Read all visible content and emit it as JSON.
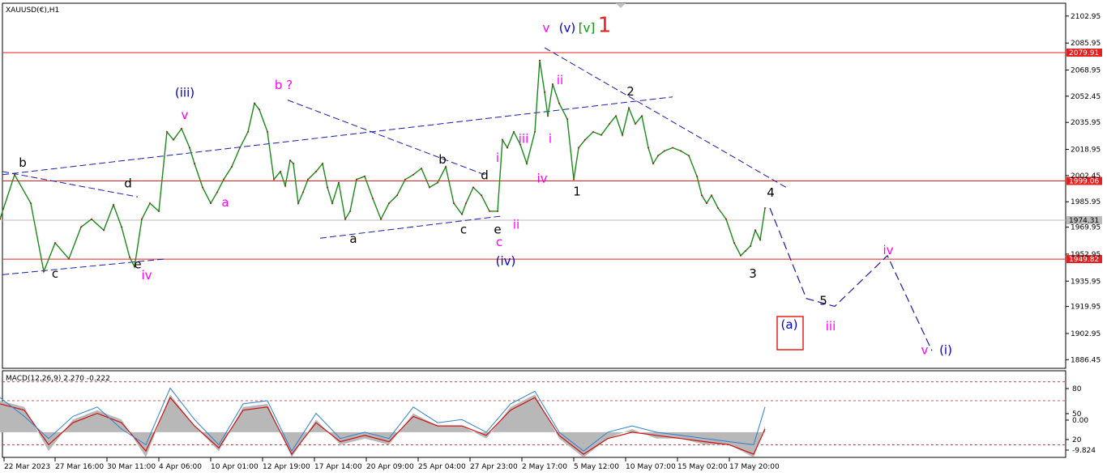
{
  "chart_data": {
    "type": "line",
    "title": "XAUUSD(€),H1",
    "price_panel": {
      "ylim": [
        1881.0,
        2110.0
      ],
      "y_ticks": [
        "2102.95",
        "2085.95",
        "2068.95",
        "2052.45",
        "2035.95",
        "2018.95",
        "2002.45",
        "1985.95",
        "1969.95",
        "1952.95",
        "1935.95",
        "1919.95",
        "1902.95",
        "1886.45"
      ],
      "y_tick_values": [
        2102.95,
        2085.95,
        2068.95,
        2052.45,
        2035.95,
        2018.95,
        2002.45,
        1985.95,
        1969.95,
        1952.95,
        1935.95,
        1919.95,
        1902.95,
        1886.45
      ],
      "levels": [
        {
          "label": "2079.91",
          "value": 2079.91,
          "color": "#e52020"
        },
        {
          "label": "1999.06",
          "value": 1999.06,
          "color": "#e52020"
        },
        {
          "label": "1974.31",
          "value": 1974.31,
          "color": "#bbbbbb"
        },
        {
          "label": "1949.82",
          "value": 1949.82,
          "color": "#e52020"
        }
      ],
      "price_path_bars": [
        0,
        18,
        38,
        54,
        68,
        85,
        100,
        113,
        128,
        140,
        150,
        160,
        166,
        175,
        185,
        196,
        206,
        214,
        224,
        234,
        240,
        250,
        260,
        268,
        276,
        286,
        296,
        306,
        314,
        320,
        330,
        338,
        346,
        352,
        358,
        362,
        368,
        374,
        380,
        390,
        398,
        404,
        410,
        418,
        426,
        432,
        440,
        450,
        460,
        470,
        480,
        490,
        500,
        510,
        520,
        530,
        540,
        550,
        560,
        570,
        575,
        584,
        594,
        604,
        614,
        620,
        626,
        634,
        642,
        650,
        660,
        666,
        672,
        676,
        682,
        690,
        700,
        708,
        714,
        722,
        732,
        742,
        752,
        760,
        768,
        776,
        784,
        792,
        800,
        806,
        812,
        820,
        830,
        840,
        850,
        860,
        866,
        872,
        878,
        886,
        896,
        906,
        914,
        920,
        926,
        932,
        938,
        944
      ],
      "price_path_values": [
        1975,
        2003,
        1985,
        1942,
        1960,
        1950,
        1970,
        1975,
        1968,
        1984,
        1970,
        1951,
        1945,
        1975,
        1985,
        1980,
        2030,
        2025,
        2032,
        2020,
        2010,
        1995,
        1985,
        1992,
        2000,
        2008,
        2020,
        2030,
        2048,
        2044,
        2030,
        2000,
        2005,
        1996,
        2012,
        2010,
        1985,
        1992,
        2000,
        2005,
        2010,
        1995,
        1985,
        1998,
        1975,
        1980,
        2000,
        2002,
        1988,
        1975,
        1985,
        1990,
        2000,
        2003,
        2007,
        1995,
        1998,
        2008,
        1985,
        1978,
        1985,
        1995,
        1990,
        1980,
        1980,
        2025,
        2020,
        2030,
        2022,
        2010,
        2030,
        2075,
        2055,
        2040,
        2060,
        2048,
        2038,
        2000,
        2020,
        2025,
        2030,
        2028,
        2035,
        2040,
        2028,
        2045,
        2035,
        2040,
        2020,
        2010,
        2015,
        2018,
        2020,
        2018,
        2015,
        2002,
        1990,
        1985,
        1990,
        1982,
        1975,
        1960,
        1952,
        1955,
        1958,
        1968,
        1962,
        1982
      ],
      "projection_x_bars": [
        950,
        995,
        1030,
        1095,
        1150
      ],
      "projection_y_values": [
        1982,
        1925,
        1920,
        1952,
        1892
      ],
      "wave_labels": [
        {
          "text": "b",
          "bar": 28,
          "value": 2008,
          "color": "#000000"
        },
        {
          "text": "c",
          "bar": 68,
          "value": 1938,
          "color": "#000000"
        },
        {
          "text": "d",
          "bar": 158,
          "value": 1995,
          "color": "#000000"
        },
        {
          "text": "e",
          "bar": 170,
          "value": 1944,
          "color": "#000000"
        },
        {
          "text": "iv",
          "bar": 181,
          "value": 1937,
          "color": "#ff00ff"
        },
        {
          "text": "(iii)",
          "bar": 228,
          "value": 2052,
          "color": "#0000cc"
        },
        {
          "text": "v",
          "bar": 228,
          "value": 2038,
          "color": "#ff00ff"
        },
        {
          "text": "a",
          "bar": 278,
          "value": 1983,
          "color": "#ff00ff"
        },
        {
          "text": "b ?",
          "bar": 350,
          "value": 2057,
          "color": "#ff00ff"
        },
        {
          "text": "a",
          "bar": 436,
          "value": 1960,
          "color": "#000000"
        },
        {
          "text": "b",
          "bar": 546,
          "value": 2010,
          "color": "#000000"
        },
        {
          "text": "c",
          "bar": 572,
          "value": 1966,
          "color": "#000000"
        },
        {
          "text": "d",
          "bar": 598,
          "value": 2000,
          "color": "#000000"
        },
        {
          "text": "e",
          "bar": 614,
          "value": 1966,
          "color": "#000000"
        },
        {
          "text": "c",
          "bar": 616,
          "value": 1958,
          "color": "#ff00ff"
        },
        {
          "text": "(iv)",
          "bar": 624,
          "value": 1946,
          "color": "#0000cc"
        },
        {
          "text": "i",
          "bar": 614,
          "value": 2011,
          "color": "#ff00ff"
        },
        {
          "text": "ii",
          "bar": 637,
          "value": 1969,
          "color": "#ff00ff"
        },
        {
          "text": "iii",
          "bar": 646,
          "value": 2023,
          "color": "#ff00ff"
        },
        {
          "text": "iv",
          "bar": 669,
          "value": 1998,
          "color": "#ff00ff"
        },
        {
          "text": "i",
          "bar": 679,
          "value": 2023,
          "color": "#ff00ff"
        },
        {
          "text": "ii",
          "bar": 691,
          "value": 2060,
          "color": "#ff00ff"
        },
        {
          "text": "v",
          "bar": 674,
          "value": 2093,
          "color": "#ff00ff"
        },
        {
          "text": "(v)",
          "bar": 700,
          "value": 2093,
          "color": "#0000cc"
        },
        {
          "text": "[v]",
          "bar": 724,
          "value": 2093,
          "color": "#009900"
        },
        {
          "text": "1",
          "bar": 746,
          "value": 2093,
          "color": "#e52020"
        },
        {
          "text": "1",
          "bar": 712,
          "value": 1990,
          "color": "#000000"
        },
        {
          "text": "2",
          "bar": 778,
          "value": 2053,
          "color": "#000000"
        },
        {
          "text": "4",
          "bar": 951,
          "value": 1989,
          "color": "#000000"
        },
        {
          "text": "3",
          "bar": 929,
          "value": 1938,
          "color": "#000000"
        },
        {
          "text": "5",
          "bar": 1016,
          "value": 1921,
          "color": "#000000"
        },
        {
          "text": "iv",
          "bar": 1096,
          "value": 1953,
          "color": "#ff00ff"
        },
        {
          "text": "iii",
          "bar": 1025,
          "value": 1905,
          "color": "#ff00ff"
        },
        {
          "text": "(a)",
          "bar": 974,
          "value": 1906,
          "color": "#0000cc"
        },
        {
          "text": "v",
          "bar": 1141,
          "value": 1890,
          "color": "#ff00ff"
        },
        {
          "text": "(i)",
          "bar": 1167,
          "value": 1890,
          "color": "#0000cc"
        }
      ]
    },
    "macd_panel": {
      "title": "MACD(12,26,9) 2.270 -0.222",
      "y_ticks": [
        "80",
        "50",
        "0.00",
        "20",
        "-9.824"
      ],
      "y_tick_values": [
        80,
        50,
        0,
        -20,
        -9.824
      ],
      "dotted_levels": [
        80,
        50,
        -20
      ],
      "ylim": [
        -40,
        95
      ],
      "hist_bars": [
        0,
        30,
        60,
        90,
        120,
        150,
        180,
        210,
        240,
        270,
        300,
        330,
        360,
        390,
        420,
        450,
        480,
        510,
        540,
        570,
        600,
        630,
        660,
        690,
        720,
        750,
        780,
        810,
        840,
        870,
        900,
        930,
        944
      ],
      "hist_values": [
        50,
        40,
        -30,
        20,
        35,
        20,
        -40,
        60,
        10,
        -30,
        40,
        45,
        -40,
        20,
        -20,
        -10,
        -20,
        30,
        10,
        10,
        -10,
        40,
        60,
        -10,
        -40,
        -10,
        5,
        -10,
        -10,
        -20,
        -20,
        -40,
        10
      ],
      "signal_values": [
        45,
        35,
        -20,
        15,
        30,
        15,
        -30,
        55,
        10,
        -25,
        35,
        40,
        -35,
        15,
        -15,
        -5,
        -15,
        25,
        10,
        10,
        -5,
        35,
        55,
        -5,
        -35,
        -10,
        0,
        -5,
        -10,
        -15,
        -20,
        -35,
        5
      ],
      "line_values": [
        55,
        25,
        -10,
        25,
        40,
        5,
        -20,
        70,
        20,
        -20,
        45,
        50,
        -30,
        30,
        -10,
        0,
        -10,
        40,
        15,
        20,
        0,
        45,
        65,
        0,
        -30,
        0,
        10,
        0,
        -5,
        -10,
        -15,
        -20,
        40
      ]
    },
    "x_ticks": [
      "22 Mar 2023",
      "27 Mar 16:00",
      "30 Mar 11:00",
      "4 Apr 06:00",
      "10 Apr 01:00",
      "12 Apr 19:00",
      "17 Apr 14:00",
      "20 Apr 09:00",
      "25 Apr 04:00",
      "27 Apr 23:00",
      "2 May 17:00",
      "5 May 12:00",
      "10 May 07:00",
      "15 May 02:00",
      "17 May 20:00"
    ],
    "x_tick_bars": [
      5,
      68,
      132,
      196,
      260,
      324,
      388,
      452,
      516,
      580,
      644,
      708,
      772,
      836,
      900
    ]
  }
}
